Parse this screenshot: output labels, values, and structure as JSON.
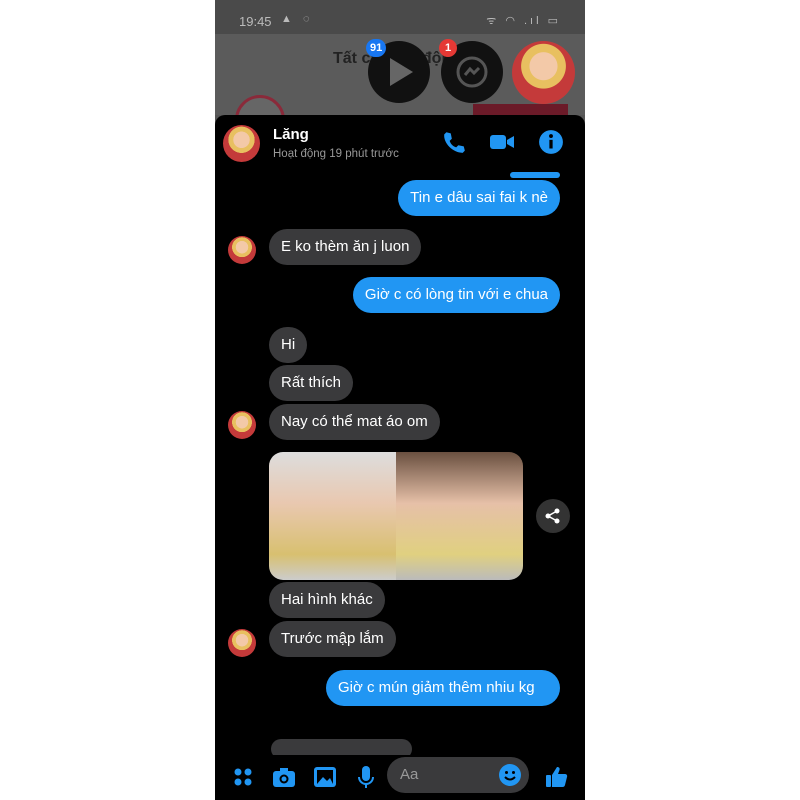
{
  "status_bar": {
    "time": "19:45"
  },
  "background": {
    "title": "Tất cả hoạt động"
  },
  "chat_heads": [
    {
      "icon": "video-play-icon",
      "badge": "91",
      "badge_color": "#1877f2"
    },
    {
      "icon": "messenger-icon",
      "badge": "1",
      "badge_color": "#e53935"
    }
  ],
  "header": {
    "name": "Lăng",
    "status": "Hoạt động 19 phút trước"
  },
  "messages": [
    {
      "from": "me",
      "text": "Tin e dâu sai fai k nè"
    },
    {
      "from": "them",
      "text": "E ko thèm ăn j luon"
    },
    {
      "from": "me",
      "text": "Giờ c có lòng tin với e chua"
    },
    {
      "from": "them",
      "text": "Hi"
    },
    {
      "from": "them",
      "text": "Rất thích"
    },
    {
      "from": "them",
      "text": "Nay có thể mat áo om"
    },
    {
      "from": "them",
      "text": "Hai hình khác"
    },
    {
      "from": "them",
      "text": "Trước mập lắm"
    },
    {
      "from": "me",
      "text": "Giờ c mún giảm thêm nhiu kg"
    }
  ],
  "composer": {
    "placeholder": "Aa"
  },
  "colors": {
    "accent": "#2196f3",
    "incoming": "#3a3a3c"
  }
}
